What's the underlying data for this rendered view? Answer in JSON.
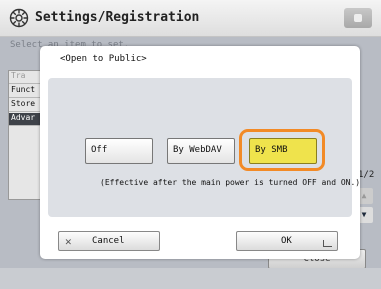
{
  "header": {
    "title": "Settings/Registration"
  },
  "background": {
    "subtitle": "Select an item to set.",
    "list": {
      "items": [
        "Tra",
        "Funct",
        "Store",
        "Advar"
      ]
    },
    "page_indicator": "1/2",
    "close_label": "Close"
  },
  "dialog": {
    "title": "<Open to Public>",
    "options": [
      "Off",
      "By WebDAV",
      "By SMB"
    ],
    "selected": "By SMB",
    "note": "(Effective after the main power is turned OFF and ON.)",
    "cancel_label": "Cancel",
    "ok_label": "OK"
  },
  "colors": {
    "selected_option": "#efe34c",
    "highlight_ring": "#f28a26",
    "advanced_row": "#3e4249"
  },
  "icons": {
    "header": "gear-icon",
    "home": "home-icon",
    "cancel": "x-icon"
  }
}
